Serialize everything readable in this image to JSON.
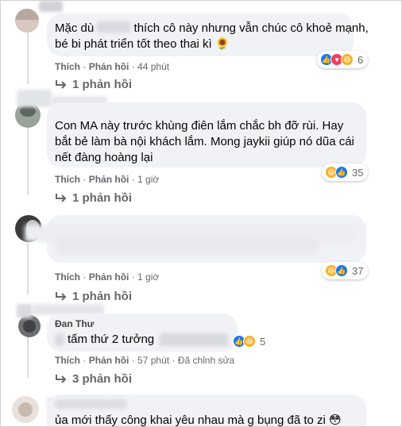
{
  "comments": [
    {
      "text_prefix": "Mặc dù",
      "text_line1_rest": "thích cô này nhưng vẫn chúc cô khoẻ mạnh,",
      "text_line2": "bé bi phát triển tốt theo thai kì 🌻",
      "like_label": "Thích",
      "reply_label": "Phản hồi",
      "time": "44 phút",
      "reaction_count": "6",
      "replies_label": "1 phản hồi"
    },
    {
      "text_line1": "Con MA này trước khùng điên lắm chắc bh đỡ rùi. Hay",
      "text_line2": "bắt bẻ làm bà nội khách lắm. Mong jaykii giúp nó dũa cái",
      "text_line3": "nết đàng hoàng lại",
      "like_label": "Thích",
      "reply_label": "Phản hồi",
      "time": "1 giờ",
      "reaction_count": "35",
      "replies_label": "1 phản hồi"
    },
    {
      "like_label": "Thích",
      "reply_label": "Phản hồi",
      "time": "1 giờ",
      "reaction_count": "37",
      "replies_label": "1 phản hồi"
    },
    {
      "author": "Đan Thư",
      "text_rest": "tấm thứ 2 tưởng",
      "like_label": "Thích",
      "reply_label": "Phản hồi",
      "time": "57 phút",
      "edited": "Đã chỉnh sửa",
      "reaction_count": "5",
      "replies_label": "3 phản hồi"
    },
    {
      "text": "ủa mới thấy công khai yêu nhau mà g bụng đã to zi 😳"
    }
  ],
  "separator": "·",
  "icons": {
    "like": "like-icon",
    "love": "love-icon",
    "haha": "haha-icon",
    "reply_arrow": "reply-arrow-icon"
  },
  "colors": {
    "bubble": "#f0f2f5",
    "meta": "#65676b",
    "like": "#1877f2",
    "love": "#f33e58",
    "haha": "#f7b125"
  }
}
